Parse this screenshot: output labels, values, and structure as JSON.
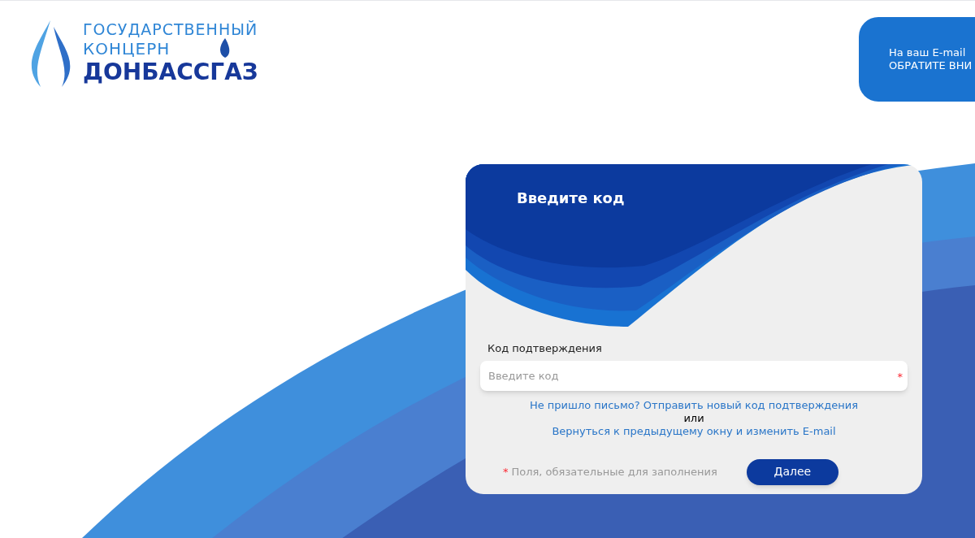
{
  "logo": {
    "line_1": "ГОСУДАРСТВЕННЫЙ",
    "line_2": "КОНЦЕРН",
    "line_3": "ДОНБАССГАЗ"
  },
  "notification": {
    "lines": [
      "На ваш E-mail",
      "ОБРАТИТЕ ВНИ"
    ]
  },
  "form": {
    "title": "Введите код",
    "field": {
      "label": "Код подтверждения",
      "placeholder": "Введите код",
      "required_mark": "*"
    },
    "resend_link": "Не пришло письмо? Отправить новый код подтверждения",
    "separator": "или",
    "back_link": "Вернуться к предыдущему окну и изменить E-mail",
    "required_note": {
      "mark": "*",
      "text": "Поля, обязательные для заполнения"
    },
    "submit_button": "Далее"
  }
}
